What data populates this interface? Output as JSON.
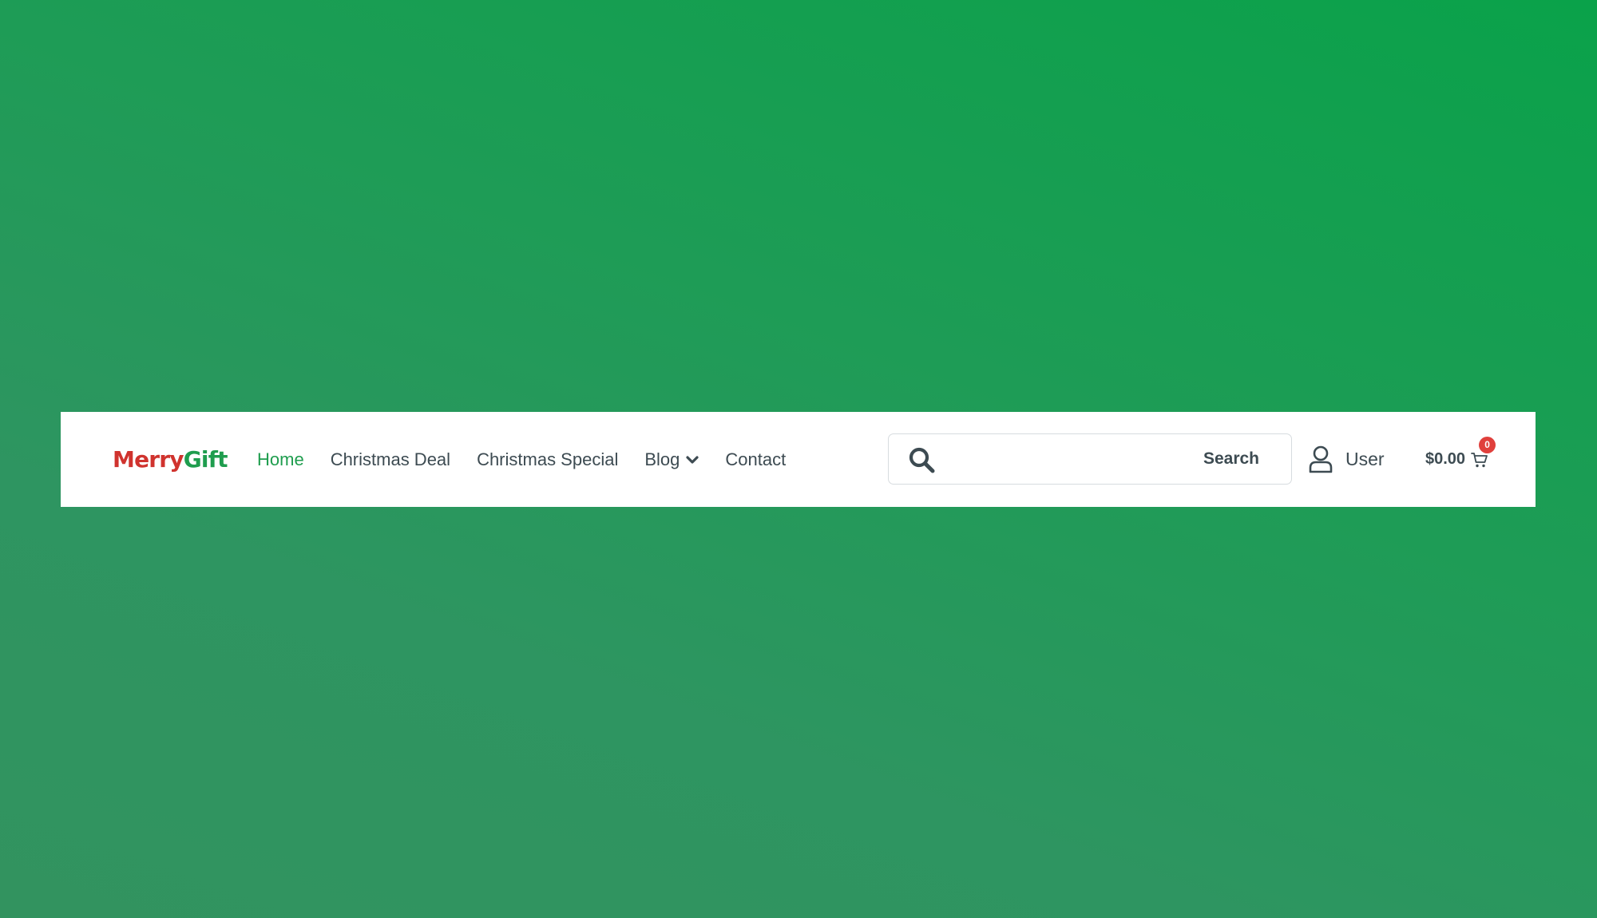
{
  "logo": {
    "part1": "Merry",
    "part2": "Gift"
  },
  "nav": {
    "items": [
      {
        "label": "Home",
        "active": true
      },
      {
        "label": "Christmas Deal"
      },
      {
        "label": "Christmas Special"
      },
      {
        "label": "Blog",
        "has_dropdown": true
      },
      {
        "label": "Contact"
      }
    ]
  },
  "search": {
    "icon": "search-icon",
    "placeholder": "",
    "value": "",
    "button_label": "Search"
  },
  "user": {
    "icon": "user-icon",
    "label": "User"
  },
  "cart": {
    "icon": "cart-icon",
    "amount": "$0.00",
    "count": "0"
  },
  "colors": {
    "brand_red": "#d0332e",
    "brand_green": "#1f9d4e",
    "text": "#3d4b52",
    "badge": "#e0403c",
    "background_top": "#0aa24a",
    "background_bottom": "#32935f"
  }
}
